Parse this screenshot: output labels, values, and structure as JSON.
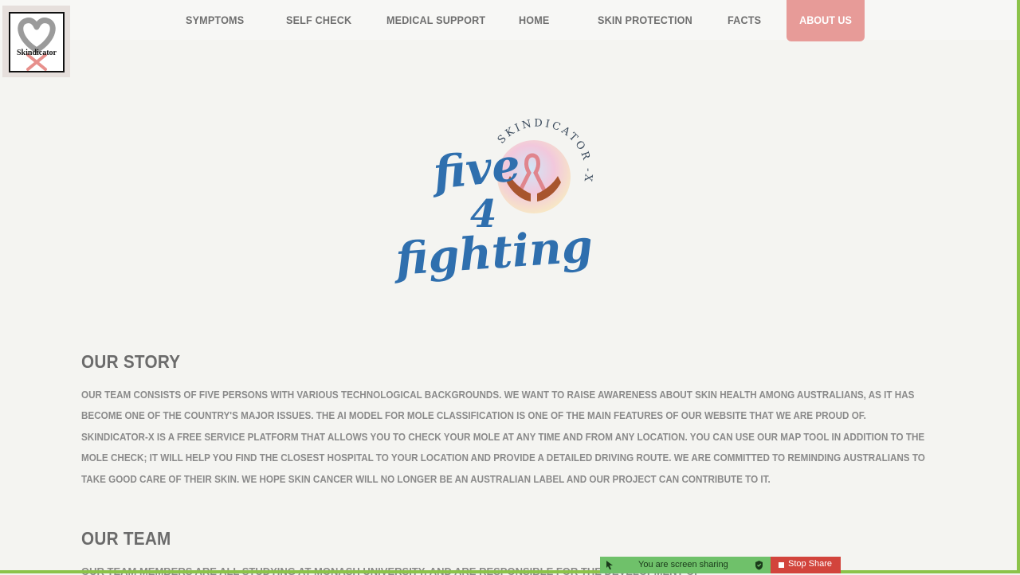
{
  "brand": {
    "logo_text": "Skindicator"
  },
  "nav": {
    "items": [
      "SYMPTOMS",
      "SELF CHECK",
      "MEDICAL SUPPORT",
      "HOME",
      "SKIN PROTECTION",
      "FACTS"
    ],
    "active": "ABOUT US"
  },
  "hero": {
    "line1": "five",
    "line2": "4",
    "line3": "fighting",
    "arc_text": "SKINDICATOR -X"
  },
  "story": {
    "title": "OUR STORY",
    "body": "OUR TEAM CONSISTS OF FIVE PERSONS WITH VARIOUS TECHNOLOGICAL BACKGROUNDS. WE WANT TO RAISE AWARENESS ABOUT SKIN HEALTH AMONG AUSTRALIANS, AS IT HAS BECOME ONE OF THE COUNTRY'S MAJOR ISSUES. THE AI MODEL FOR MOLE CLASSIFICATION IS ONE OF THE MAIN FEATURES OF OUR WEBSITE THAT WE ARE PROUD OF. SKINDICATOR-X IS A FREE SERVICE PLATFORM THAT ALLOWS YOU TO CHECK YOUR MOLE AT ANY TIME AND FROM ANY LOCATION. YOU CAN USE OUR MAP TOOL IN ADDITION TO THE MOLE CHECK; IT WILL HELP YOU FIND THE CLOSEST HOSPITAL TO YOUR LOCATION AND PROVIDE A DETAILED DRIVING ROUTE. WE ARE COMMITTED TO REMINDING AUSTRALIANS TO TAKE GOOD CARE OF THEIR SKIN. WE HOPE SKIN CANCER WILL NO LONGER BE AN AUSTRALIAN LABEL AND OUR PROJECT CAN CONTRIBUTE TO IT."
  },
  "team": {
    "title": "OUR TEAM",
    "body_partial": "OUR TEAM MEMBERS ARE ALL STUDYING AT MONASH UNIVERSITY, AND ARE RESPONSIBLE FOR THE DEVELOPMENT OF"
  },
  "screen_share": {
    "message": "You are screen sharing",
    "stop_label": "Stop Share"
  },
  "colors": {
    "accent": "#e79b98",
    "text": "#8a8a8a",
    "heading": "#6b6b6b",
    "hero_blue": "#2f6fae",
    "frame_green": "#8cc34a"
  }
}
